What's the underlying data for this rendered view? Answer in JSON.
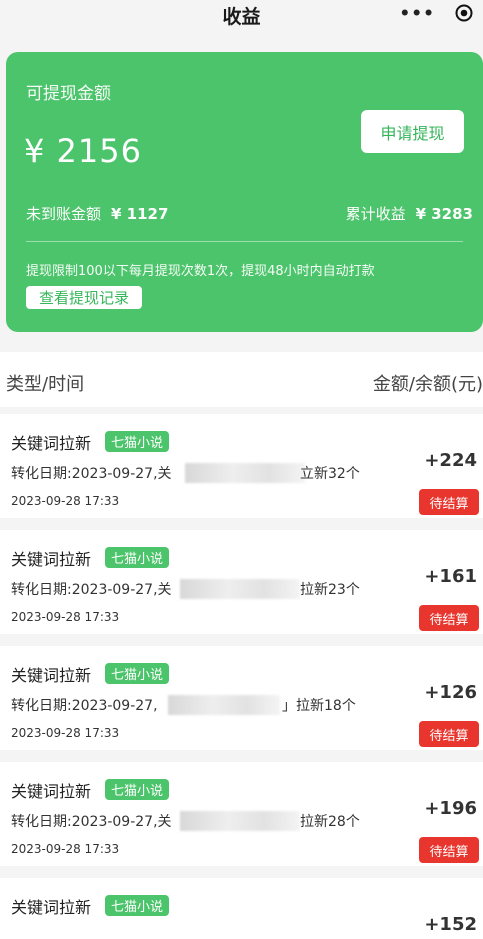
{
  "header": {
    "title": "收益",
    "more": "•••"
  },
  "card": {
    "available_label": "可提现金额",
    "available_amount": "¥ 2156",
    "withdraw_button": "申请提现",
    "pending_label": "未到账金额",
    "pending_value": "¥ 1127",
    "total_label": "累计收益",
    "total_value": "¥ 3283",
    "notice": "提现限制100以下每月提现次数1次，提现48小时内自动打款",
    "records_button": "查看提现记录",
    "accent_color": "#4cc46b"
  },
  "list_header": {
    "left": "类型/时间",
    "right": "金额/余额(元)"
  },
  "records": [
    {
      "title": "关键词拉新",
      "tag": "七猫小说",
      "conv_prefix": "转化日期:2023-09-27,关",
      "conv_suffix": "立新32个",
      "time": "2023-09-28 17:33",
      "amount": "+224",
      "status": "待结算"
    },
    {
      "title": "关键词拉新",
      "tag": "七猫小说",
      "conv_prefix": "转化日期:2023-09-27,关",
      "conv_suffix": "拉新23个",
      "time": "2023-09-28 17:33",
      "amount": "+161",
      "status": "待结算"
    },
    {
      "title": "关键词拉新",
      "tag": "七猫小说",
      "conv_prefix": "转化日期:2023-09-27,",
      "conv_suffix": "」拉新18个",
      "time": "2023-09-28 17:33",
      "amount": "+126",
      "status": "待结算"
    },
    {
      "title": "关键词拉新",
      "tag": "七猫小说",
      "conv_prefix": "转化日期:2023-09-27,关",
      "conv_suffix": "拉新28个",
      "time": "2023-09-28 17:33",
      "amount": "+196",
      "status": "待结算"
    },
    {
      "title": "关键词拉新",
      "tag": "七猫小说",
      "conv_prefix": "",
      "conv_suffix": "",
      "time": "",
      "amount": "+152",
      "status": ""
    }
  ],
  "status_color": "#e8362e"
}
